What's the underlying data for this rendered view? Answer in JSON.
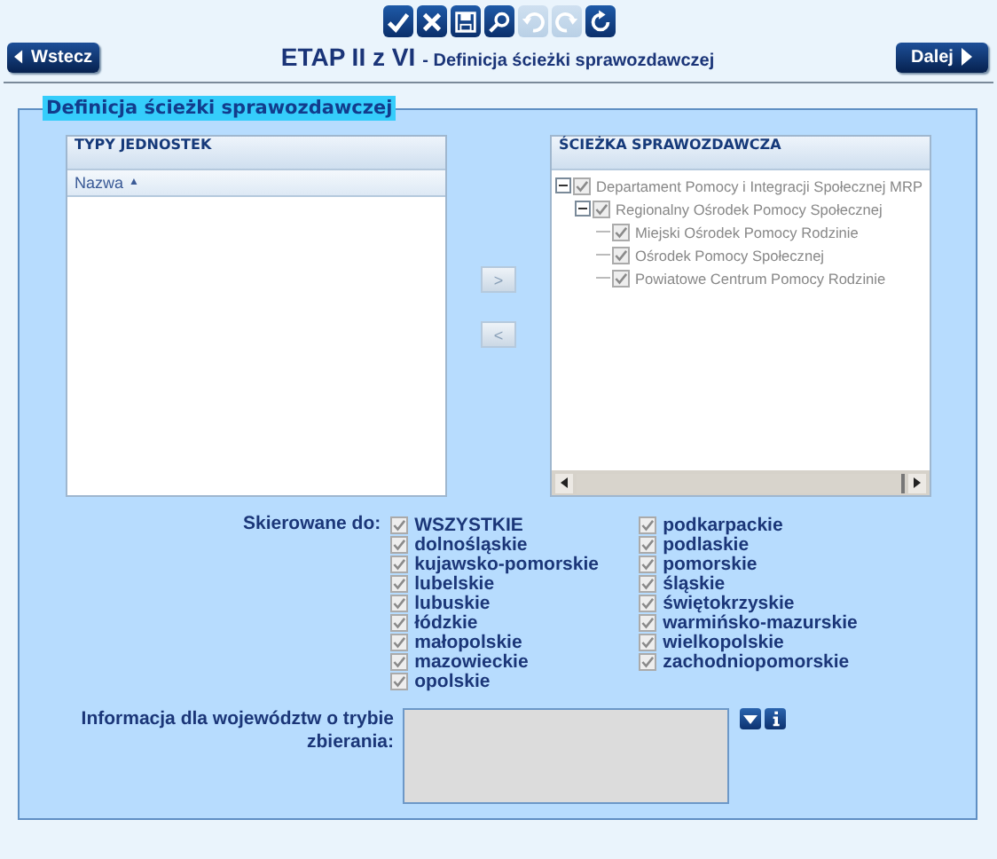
{
  "toolbar": [
    {
      "kind": "check",
      "disabled": false
    },
    {
      "kind": "close",
      "disabled": false
    },
    {
      "kind": "save",
      "disabled": false
    },
    {
      "kind": "search",
      "disabled": false
    },
    {
      "kind": "undo",
      "disabled": true
    },
    {
      "kind": "redo",
      "disabled": true
    },
    {
      "kind": "refresh",
      "disabled": false
    }
  ],
  "back_button": "Wstecz",
  "next_button": "Dalej",
  "title": {
    "stage": "ETAP II z VI",
    "subtitle": "- Definicja ścieżki sprawozdawczej"
  },
  "section": {
    "legend": "Definicja ścieżki sprawozdawczej"
  },
  "unit_types": {
    "title": "TYPY JEDNOSTEK",
    "column": "Nazwa",
    "sort_mark": "▲"
  },
  "move_buttons": [
    ">",
    "<"
  ],
  "path": {
    "title": "ŚCIEŻKA SPRAWOZDAWCZA",
    "tree": [
      {
        "label": "Departament Pomocy i Integracji Społecznej MRP",
        "checked": true,
        "expanded": true,
        "children": [
          {
            "label": "Regionalny Ośrodek Pomocy Społecznej",
            "checked": true,
            "expanded": true,
            "children": [
              {
                "label": "Miejski Ośrodek Pomocy Rodzinie",
                "checked": true
              },
              {
                "label": "Ośrodek Pomocy Społecznej",
                "checked": true
              },
              {
                "label": "Powiatowe Centrum Pomocy Rodzinie",
                "checked": true
              }
            ]
          }
        ]
      }
    ]
  },
  "directed_to": {
    "label": "Skierowane do:",
    "columns": [
      [
        {
          "label": "WSZYSTKIE",
          "checked": true
        },
        {
          "label": "dolnośląskie",
          "checked": true
        },
        {
          "label": "kujawsko-pomorskie",
          "checked": true
        },
        {
          "label": "lubelskie",
          "checked": true
        },
        {
          "label": "lubuskie",
          "checked": true
        },
        {
          "label": "łódzkie",
          "checked": true
        },
        {
          "label": "małopolskie",
          "checked": true
        },
        {
          "label": "mazowieckie",
          "checked": true
        },
        {
          "label": "opolskie",
          "checked": true
        }
      ],
      [
        {
          "label": "podkarpackie",
          "checked": true
        },
        {
          "label": "podlaskie",
          "checked": true
        },
        {
          "label": "pomorskie",
          "checked": true
        },
        {
          "label": "śląskie",
          "checked": true
        },
        {
          "label": "świętokrzyskie",
          "checked": true
        },
        {
          "label": "warmińsko-mazurskie",
          "checked": true
        },
        {
          "label": "wielkopolskie",
          "checked": true
        },
        {
          "label": "zachodniopomorskie",
          "checked": true
        }
      ]
    ]
  },
  "info": {
    "label": "Informacja dla województw o trybie zbierania:"
  }
}
